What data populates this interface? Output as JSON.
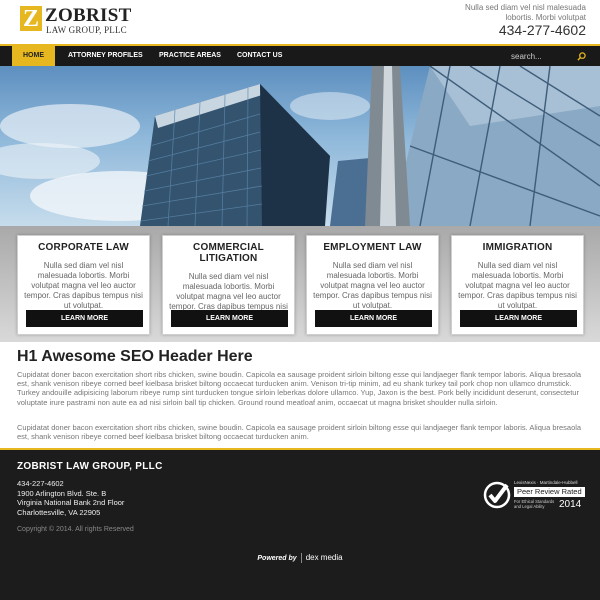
{
  "header": {
    "logo_letter": "Z",
    "logo_name": "ZOBRIST",
    "logo_subtitle": "LAW GROUP, PLLC",
    "tagline": "Nulla sed diam vel nisl malesuada lobortis. Morbi volutpat",
    "phone": "434-277-4602"
  },
  "nav": {
    "items": [
      {
        "label": "HOME",
        "active": true
      },
      {
        "label": "ATTORNEY PROFILES",
        "active": false
      },
      {
        "label": "PRACTICE AREAS",
        "active": false
      },
      {
        "label": "CONTACT US",
        "active": false
      }
    ],
    "search_placeholder": "search..."
  },
  "practice_areas": [
    {
      "title": "CORPORATE LAW",
      "text": "Nulla sed diam vel nisl malesuada lobortis. Morbi volutpat magna vel leo auctor tempor. Cras dapibus tempus nisi ut volutpat.",
      "button": "LEARN MORE"
    },
    {
      "title": "COMMERCIAL LITIGATION",
      "text": "Nulla sed diam vel nisl malesuada lobortis. Morbi volutpat magna vel leo auctor tempor. Cras dapibus tempus nisi ut volutpat.",
      "button": "LEARN MORE"
    },
    {
      "title": "EMPLOYMENT LAW",
      "text": "Nulla sed diam vel nisl malesuada lobortis. Morbi volutpat magna vel leo auctor tempor. Cras dapibus tempus nisi ut volutpat.",
      "button": "LEARN MORE"
    },
    {
      "title": "IMMIGRATION",
      "text": "Nulla sed diam vel nisl malesuada lobortis. Morbi volutpat magna vel leo auctor tempor. Cras dapibus tempus nisi ut volutpat.",
      "button": "LEARN MORE"
    }
  ],
  "main": {
    "heading": "H1 Awesome SEO Header Here",
    "paragraph1": "Cupidatat doner bacon exercitation short ribs chicken, swine boudin. Capicola ea sausage proident sirloin biltong esse qui landjaeger flank tempor laboris. Aliqua bresaola est, shank venison ribeye corned beef kielbasa brisket biltong occaecat turducken anim. Venison tri-tip minim, ad eu shank turkey tail pork chop non ullamco drumstick. Turkey andouille adipisicing laborum ribeye rump sint turducken tongue sirloin leberkas dolore ullamco. Yup, Jaxon is the best. Pork belly incididunt deserunt, consectetur voluptate irure pastrami non aute ea ad nisi sirloin ball tip chicken. Ground round meatloaf anim, occaecat ut magna brisket shoulder nulla sirloin.",
    "paragraph2": "Cupidatat doner bacon exercitation short ribs chicken, swine boudin. Capicola ea sausage proident sirloin biltong esse qui landjaeger flank tempor laboris. Aliqua bresaola est, shank venison ribeye corned beef kielbasa brisket biltong occaecat turducken anim."
  },
  "footer": {
    "title": "ZOBRIST LAW GROUP, PLLC",
    "phone": "434-227-4602",
    "address1": "1900 Arlington Blvd. Ste. B",
    "address2": "Virginia National Bank 2nd Floor",
    "address3": "Charlottesville, VA 22905",
    "copyright": "Copyright © 2014. All rights Reserved",
    "badge_top": "LexisNexis · Martindale-Hubbell",
    "badge_main": "Peer Review Rated",
    "badge_sub1": "For Ethical Standards",
    "badge_sub2": "and Legal Ability",
    "badge_year": "2014",
    "powered_by": "Powered by",
    "powered_brand": "dex media"
  },
  "colors": {
    "accent": "#e6b71e",
    "nav_bg": "#191919",
    "footer_bg": "#1c1c1c"
  }
}
